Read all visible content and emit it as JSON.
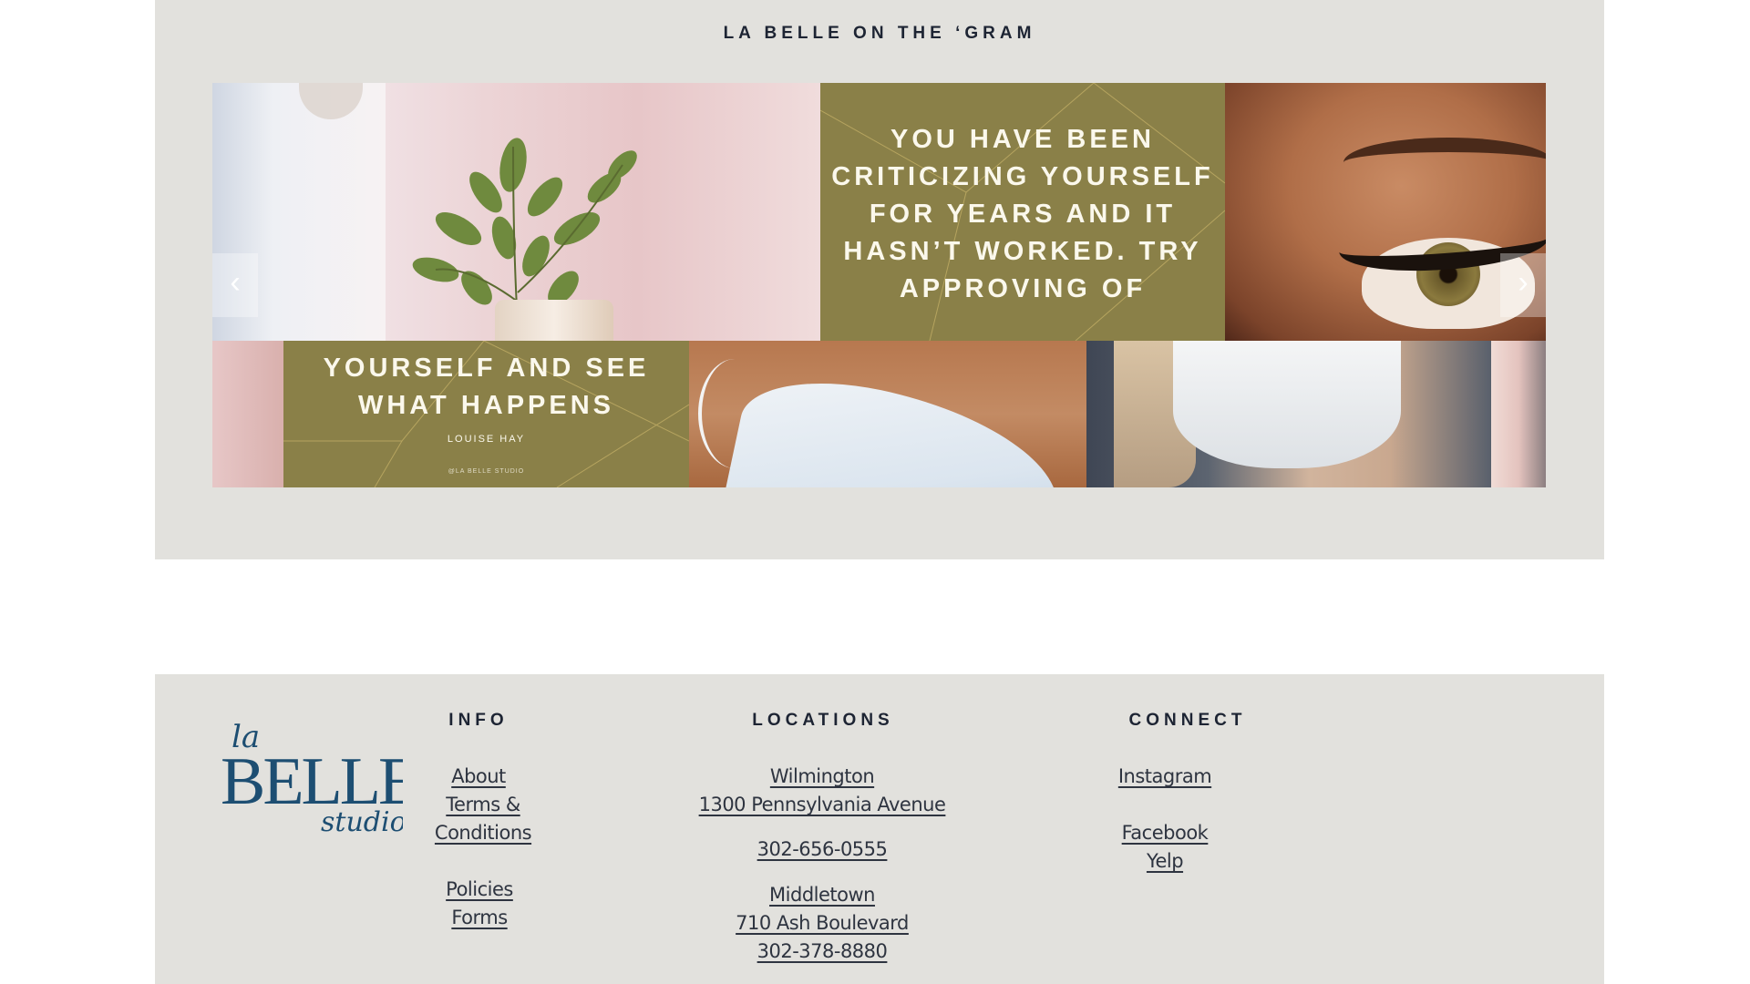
{
  "gram": {
    "title": "LA BELLE ON THE ‘GRAM",
    "quote_top": "YOU HAVE BEEN CRITICIZING YOURSELF FOR YEARS AND IT HASN’T WORKED. TRY APPROVING OF",
    "quote_bottom": "YOURSELF AND SEE WHAT HAPPENS",
    "quote_author": "LOUISE HAY",
    "quote_handle": "@LA BELLE STUDIO",
    "prev_icon": "chevron-left-icon",
    "next_icon": "chevron-right-icon",
    "prev_glyph": "‹",
    "next_glyph": "›",
    "quote_color": "#8a8048"
  },
  "footer": {
    "logo": {
      "line1": "la",
      "line2": "BELLE",
      "line3": "studio",
      "color": "#1d4e72"
    },
    "info": {
      "title": "INFO",
      "about": "About",
      "terms_line1": "Terms &",
      "terms_line2": "Conditions",
      "policies": "Policies",
      "forms": "Forms"
    },
    "locations": {
      "title": "LOCATIONS",
      "wilmington": "Wilmington",
      "wilmington_address": "1300 Pennsylvania Avenue",
      "wilmington_phone": "302-656-0555",
      "middletown": "Middletown",
      "middletown_address": "710 Ash Boulevard",
      "middletown_phone": "302-378-8880"
    },
    "connect": {
      "title": "CONNECT",
      "instagram": "Instagram",
      "facebook": "Facebook",
      "yelp": "Yelp"
    }
  },
  "colors": {
    "section_bg": "#e2e1dd",
    "heading": "#1d2433",
    "logo_blue": "#1d4e72"
  }
}
